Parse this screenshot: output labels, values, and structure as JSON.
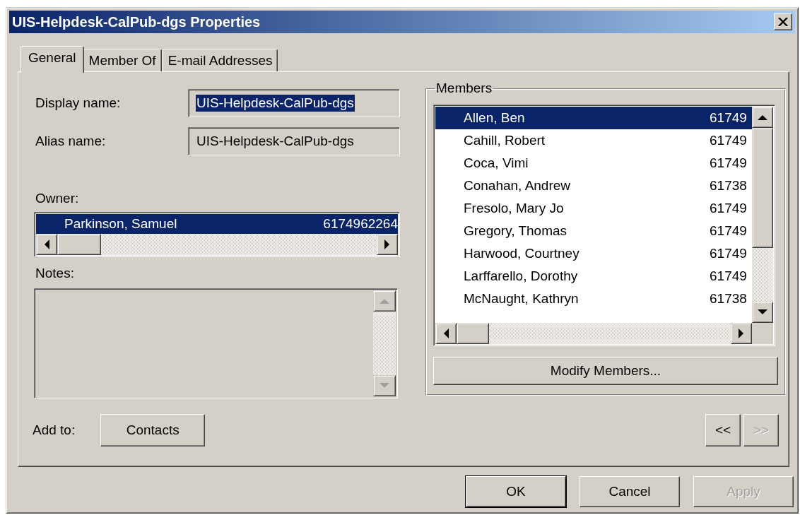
{
  "window": {
    "title": "UIS-Helpdesk-CalPub-dgs Properties"
  },
  "tabs": [
    {
      "label": "General",
      "selected": true
    },
    {
      "label": "Member Of",
      "selected": false
    },
    {
      "label": "E-mail Addresses",
      "selected": false
    }
  ],
  "display_name": {
    "label": "Display name:",
    "value": "UIS-Helpdesk-CalPub-dgs",
    "highlighted": true
  },
  "alias_name": {
    "label": "Alias name:",
    "value": "UIS-Helpdesk-CalPub-dgs",
    "highlighted": false
  },
  "owner": {
    "label": "Owner:",
    "rows": [
      {
        "name": "Parkinson, Samuel",
        "number": "6174962264",
        "selected": true
      }
    ]
  },
  "notes": {
    "label": "Notes:",
    "disabled": true
  },
  "add_to": {
    "label": "Add to:",
    "button": "Contacts"
  },
  "members": {
    "title": "Members",
    "rows": [
      {
        "name": "Allen, Ben",
        "number": "61749",
        "selected": true
      },
      {
        "name": "Cahill, Robert",
        "number": "61749",
        "selected": false
      },
      {
        "name": "Coca, Vimi",
        "number": "61749",
        "selected": false
      },
      {
        "name": "Conahan, Andrew",
        "number": "61738",
        "selected": false
      },
      {
        "name": "Fresolo, Mary Jo",
        "number": "61749",
        "selected": false
      },
      {
        "name": "Gregory, Thomas",
        "number": "61749",
        "selected": false
      },
      {
        "name": "Harwood, Courtney",
        "number": "61749",
        "selected": false
      },
      {
        "name": "Larffarello, Dorothy",
        "number": "61749",
        "selected": false
      },
      {
        "name": "McNaught, Kathryn",
        "number": "61738",
        "selected": false
      }
    ],
    "button": "Modify Members..."
  },
  "navigation": [
    {
      "label": "<<",
      "disabled": false
    },
    {
      "label": ">>",
      "disabled": true
    }
  ],
  "buttons": [
    {
      "label": "OK",
      "default": true,
      "disabled": false
    },
    {
      "label": "Cancel",
      "default": false,
      "disabled": false
    },
    {
      "label": "Apply",
      "default": false,
      "disabled": true
    }
  ]
}
